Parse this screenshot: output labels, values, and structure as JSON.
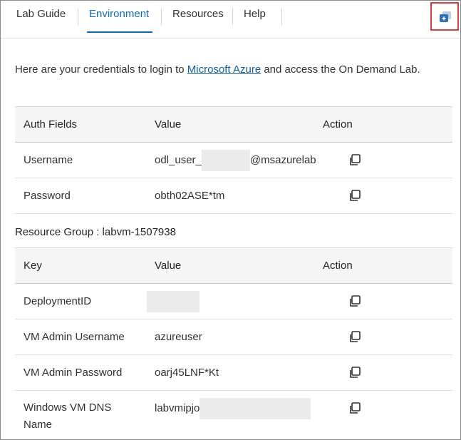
{
  "tabs": [
    {
      "label": "Lab Guide",
      "active": false
    },
    {
      "label": "Environment",
      "active": true
    },
    {
      "label": "Resources",
      "active": false
    },
    {
      "label": "Help",
      "active": false
    }
  ],
  "popout_icon": "popout-window-icon",
  "intro": {
    "prefix": "Here are your credentials to login to ",
    "link": "Microsoft Azure",
    "suffix": " and access the On Demand Lab."
  },
  "auth_table": {
    "headers": [
      "Auth Fields",
      "Value",
      "Action"
    ],
    "rows": [
      {
        "field": "Username",
        "value_prefix": "odl_user_",
        "value_suffix": "@msazurelab",
        "redacted": true
      },
      {
        "field": "Password",
        "value": "obth02ASE*tm"
      }
    ]
  },
  "resource_group": {
    "label": "Resource Group : labvm-1507938"
  },
  "resource_table": {
    "headers": [
      "Key",
      "Value",
      "Action"
    ],
    "rows": [
      {
        "key": "DeploymentID",
        "value": "",
        "redacted": true
      },
      {
        "key": "VM Admin Username",
        "value": "azureuser"
      },
      {
        "key": "VM Admin Password",
        "value": "oarj45LNF*Kt"
      },
      {
        "key_line1": "Windows VM DNS",
        "key_line2": "Name",
        "value": "labvmipjo",
        "redacted": true
      }
    ]
  },
  "colors": {
    "accent": "#0f6cbd",
    "highlight": "#e03c3c"
  }
}
